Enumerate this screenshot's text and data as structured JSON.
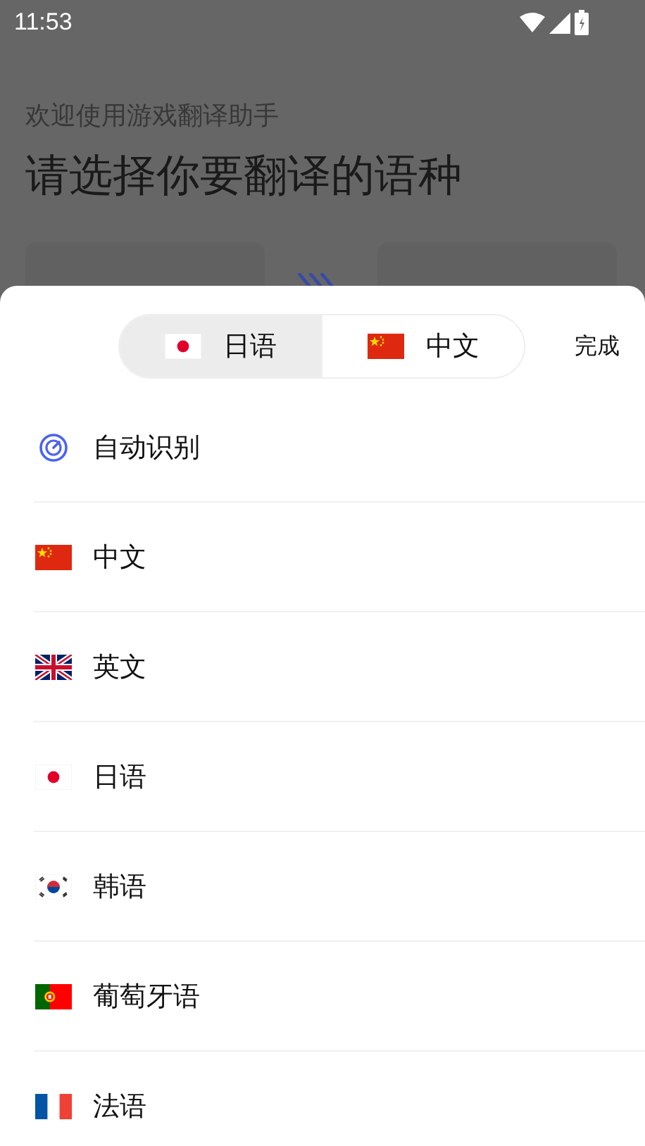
{
  "status_bar": {
    "time": "11:53"
  },
  "background": {
    "subtitle": "欢迎使用游戏翻译助手",
    "title": "请选择你要翻译的语种"
  },
  "sheet": {
    "tabs": [
      {
        "label": "日语",
        "kind": "jp",
        "selected": true
      },
      {
        "label": "中文",
        "kind": "cn",
        "selected": false
      }
    ],
    "done": "完成",
    "languages": [
      {
        "kind": "auto",
        "label": "自动识别"
      },
      {
        "kind": "cn",
        "label": "中文"
      },
      {
        "kind": "gb",
        "label": "英文"
      },
      {
        "kind": "jp",
        "label": "日语"
      },
      {
        "kind": "kr",
        "label": "韩语"
      },
      {
        "kind": "pt",
        "label": "葡萄牙语"
      },
      {
        "kind": "fr",
        "label": "法语"
      }
    ]
  }
}
